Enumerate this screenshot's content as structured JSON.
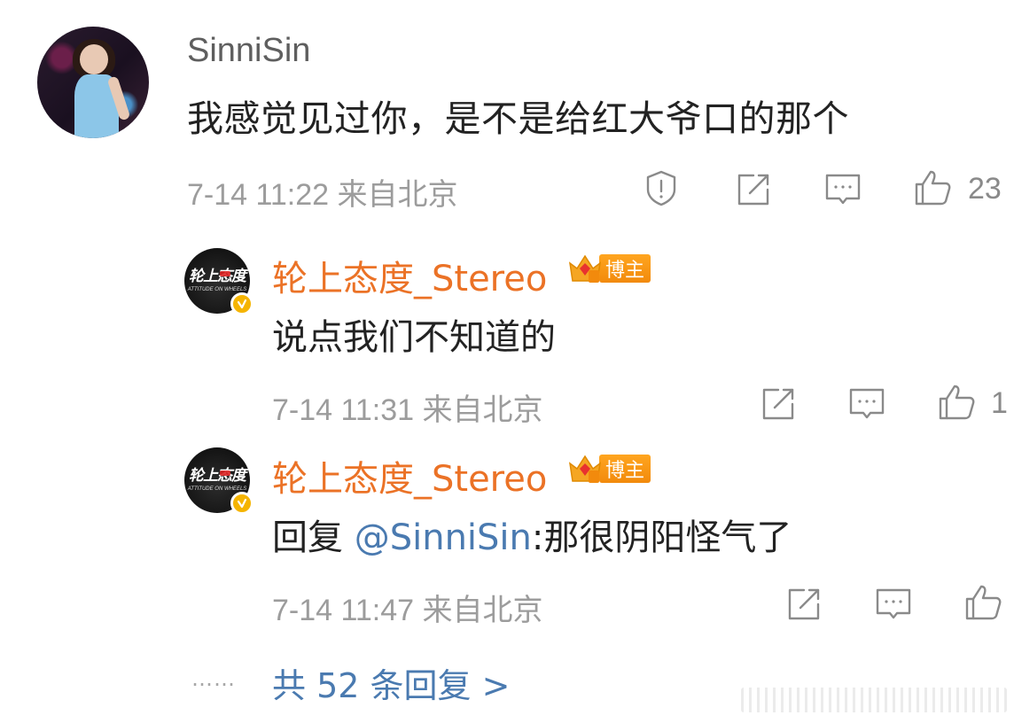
{
  "main_comment": {
    "username": "SinniSin",
    "text": "我感觉见过你，是不是给红大爷口的那个",
    "time": "7-14 11:22",
    "location": "来自北京",
    "like_count": "23",
    "icons": [
      "report-icon",
      "repost-icon",
      "comment-icon",
      "like-icon"
    ]
  },
  "replies": [
    {
      "username": "轮上态度_Stereo",
      "badge_label": "博主",
      "text": "说点我们不知道的",
      "time": "7-14 11:31",
      "location": "来自北京",
      "like_count": "1"
    },
    {
      "username": "轮上态度_Stereo",
      "badge_label": "博主",
      "reply_prefix": "回复 ",
      "mention": "@SinniSin",
      "text": ":那很阴阳怪气了",
      "time": "7-14 11:47",
      "location": "来自北京",
      "like_count": ""
    }
  ],
  "more": {
    "dots": "……",
    "label": "共 52 条回复 >"
  },
  "colors": {
    "username_orange": "#eb7226",
    "link_blue": "#4a7ab0",
    "meta_gray": "#9c9c9c",
    "badge_orange": "#f28a0c",
    "verified_gold": "#f5b400"
  }
}
